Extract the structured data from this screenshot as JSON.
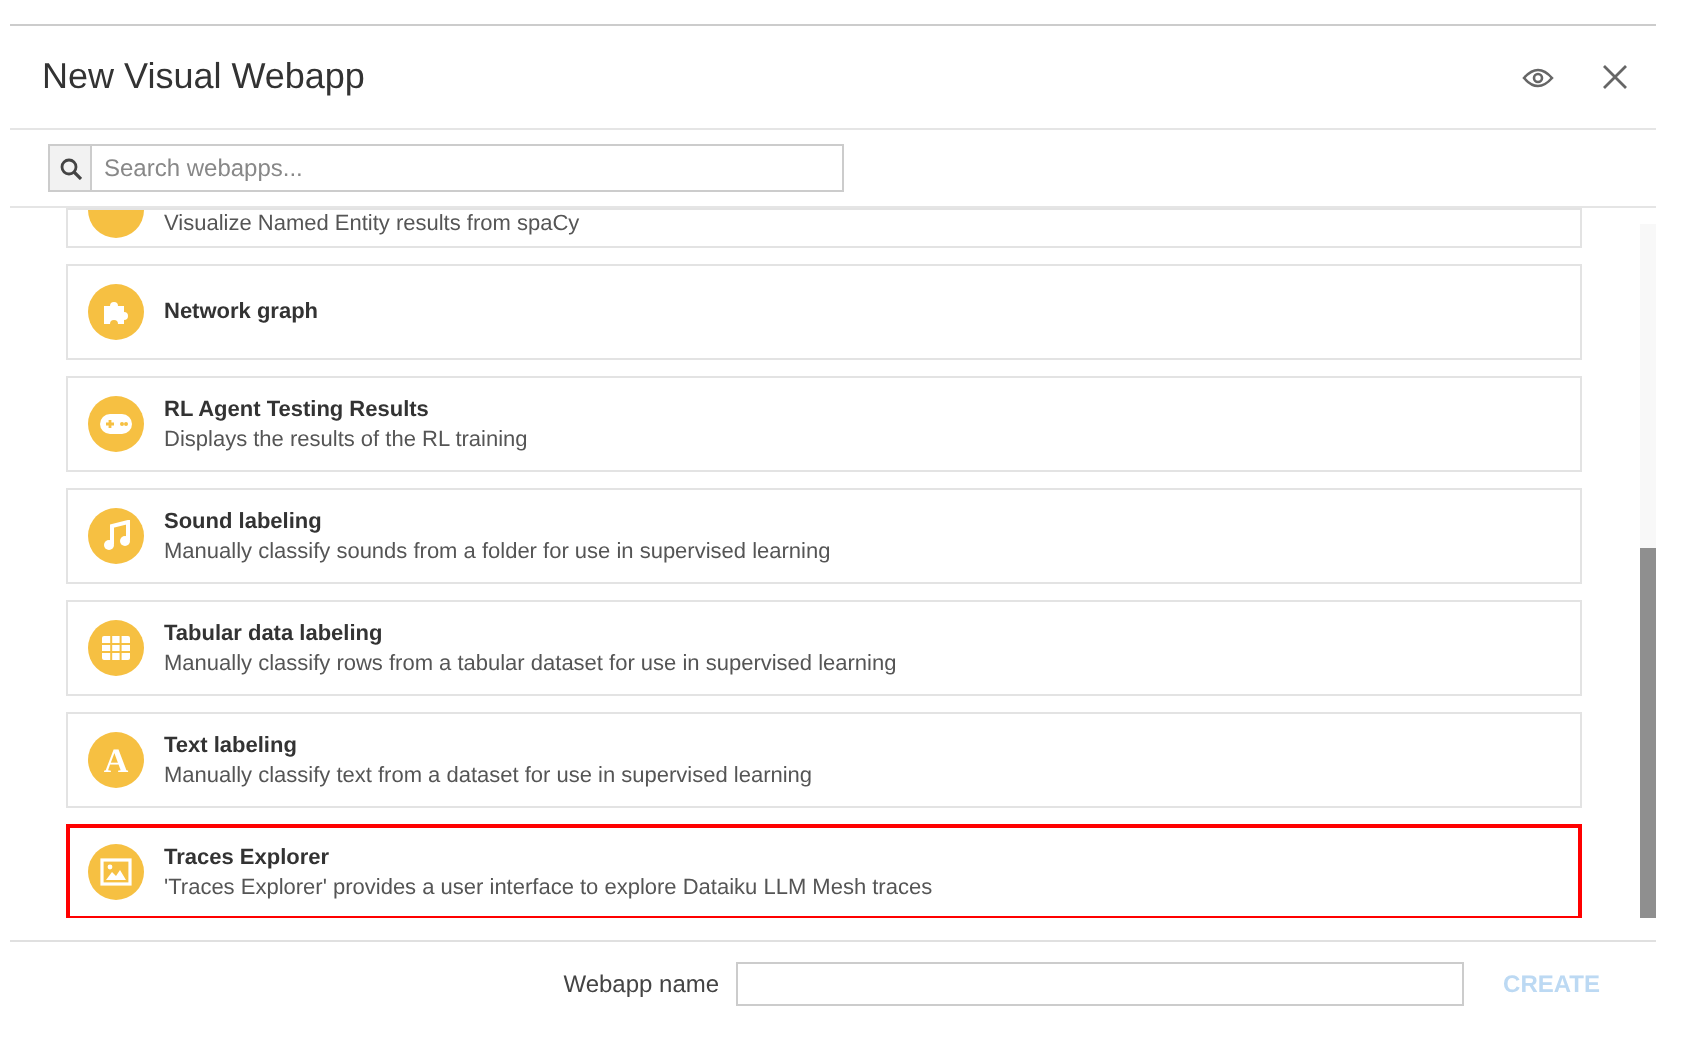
{
  "dialog": {
    "title": "New Visual Webapp"
  },
  "search": {
    "placeholder": "Search webapps..."
  },
  "webapps": [
    {
      "kind": "partial",
      "description": "Visualize Named Entity results from spaCy",
      "selected": false
    },
    {
      "kind": "puzzle",
      "title": "Network graph",
      "selected": false
    },
    {
      "kind": "gamepad",
      "title": "RL Agent Testing Results",
      "description": "Displays the results of the RL training",
      "selected": false
    },
    {
      "kind": "music",
      "title": "Sound labeling",
      "description": "Manually classify sounds from a folder for use in supervised learning",
      "selected": false
    },
    {
      "kind": "grid",
      "title": "Tabular data labeling",
      "description": "Manually classify rows from a tabular dataset for use in supervised learning",
      "selected": false
    },
    {
      "kind": "letter",
      "icon_text": "A",
      "title": "Text labeling",
      "description": "Manually classify text from a dataset for use in supervised learning",
      "selected": false
    },
    {
      "kind": "image",
      "title": "Traces Explorer",
      "description": "'Traces Explorer' provides a user interface to explore Dataiku LLM Mesh traces",
      "selected": true
    }
  ],
  "footer": {
    "name_label": "Webapp name",
    "create_button": {
      "label": "CREATE",
      "disabled": true
    }
  }
}
